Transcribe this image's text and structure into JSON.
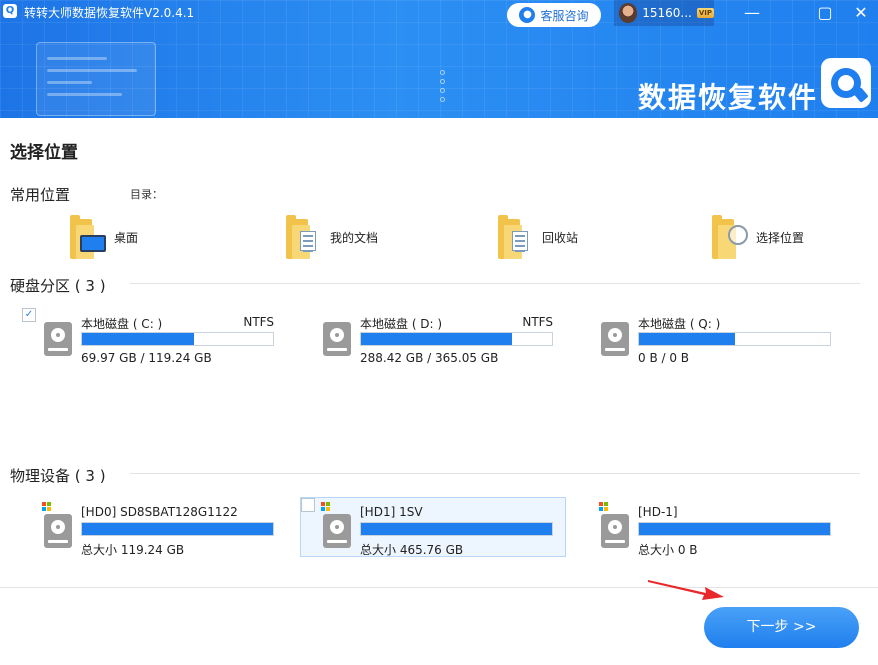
{
  "window": {
    "title": "转转大师数据恢复软件V2.0.4.1",
    "logo_glyph": "Q",
    "minimize_glyph": "—",
    "maximize_glyph": "▢",
    "close_glyph": "✕"
  },
  "header": {
    "service_label": "客服咨询",
    "user_id": "15160...",
    "vip_label": "VIP",
    "brand_text": "数据恢复软件"
  },
  "page": {
    "title": "选择位置"
  },
  "common": {
    "title": "常用位置",
    "dir_label": "目录：",
    "items": [
      {
        "label": "桌面",
        "icon": "desktop-folder-icon"
      },
      {
        "label": "我的文档",
        "icon": "documents-folder-icon"
      },
      {
        "label": "回收站",
        "icon": "recycle-bin-icon"
      },
      {
        "label": "选择位置",
        "icon": "browse-folder-icon"
      }
    ]
  },
  "partitions": {
    "title": "硬盘分区  ( 3 )",
    "items": [
      {
        "name": "本地磁盘  ( C: )",
        "fs": "NTFS",
        "size": "69.97 GB / 119.24 GB",
        "used": 0.587,
        "selected": true,
        "check": "✓"
      },
      {
        "name": "本地磁盘  ( D: )",
        "fs": "NTFS",
        "size": "288.42 GB / 365.05 GB",
        "used": 0.79,
        "selected": false,
        "check": ""
      },
      {
        "name": "本地磁盘  ( Q: )",
        "fs": "",
        "size": "0 B / 0 B",
        "used": 0.5,
        "selected": false,
        "check": ""
      }
    ]
  },
  "physical": {
    "title": "物理设备  ( 3 )",
    "items": [
      {
        "name": "[HD0] SD8SBAT128G1122",
        "size": "总大小 119.24 GB",
        "used": 1.0,
        "selected": false,
        "checkbox": false
      },
      {
        "name": "[HD1] 1SV",
        "size": "总大小 465.76 GB",
        "used": 1.0,
        "selected": true,
        "checkbox": true
      },
      {
        "name": "[HD-1]",
        "size": "总大小 0 B",
        "used": 1.0,
        "selected": false,
        "checkbox": false
      }
    ]
  },
  "footer": {
    "next_label": "下一步 >>"
  },
  "colors": {
    "accent": "#1f7fee",
    "header": "#2c8ff3",
    "arrow": "#e8282b"
  }
}
